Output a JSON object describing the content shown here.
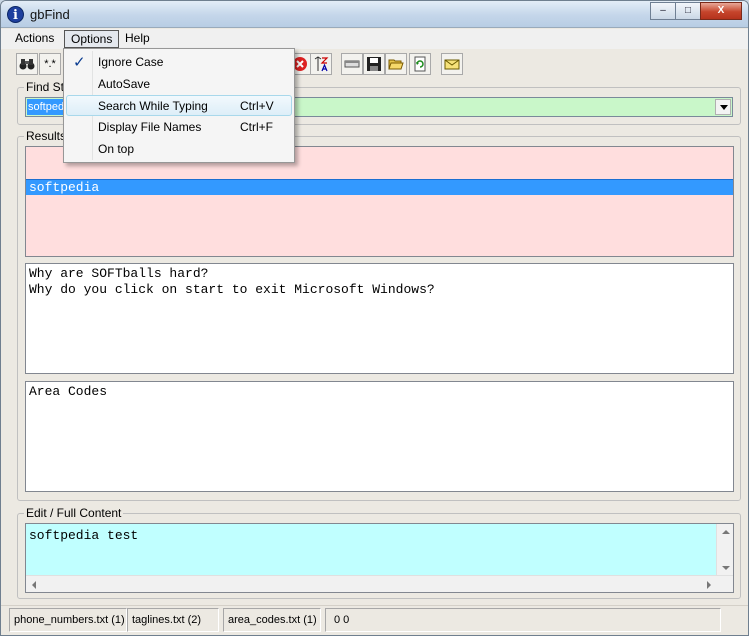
{
  "window": {
    "title": "gbFind",
    "app_icon": "i"
  },
  "window_controls": {
    "minimize": "–",
    "maximize": "□",
    "close": "X"
  },
  "menubar": {
    "actions": "Actions",
    "options": "Options",
    "help": "Help"
  },
  "toolbar": {
    "wildcard_label": "*.*"
  },
  "find": {
    "label": "Find String",
    "value": "softpedia"
  },
  "results": {
    "label": "Results",
    "row_text": "softpedia"
  },
  "taglines": {
    "lines": "Why are SOFTballs hard?\nWhy do you click on start to exit Microsoft Windows?"
  },
  "area_codes": {
    "text": "Area Codes"
  },
  "edit": {
    "label": "Edit / Full Content",
    "text": "softpedia test"
  },
  "status": {
    "file1": "phone_numbers.txt  (1)",
    "file2": "taglines.txt  (2)",
    "file3": "area_codes.txt  (1)",
    "counts": "0   0"
  },
  "options_menu": {
    "ignore_case": "Ignore Case",
    "autosave": "AutoSave",
    "search_while_typing": "Search While Typing",
    "search_while_typing_shortcut": "Ctrl+V",
    "display_file_names": "Display File Names",
    "display_file_names_shortcut": "Ctrl+F",
    "on_top": "On top",
    "checked_glyph": "✓"
  },
  "colors": {
    "find_bg": "#c9f7c9",
    "results_bg": "#ffdede",
    "edit_bg": "#c0ffff",
    "selection": "#3399ff"
  }
}
